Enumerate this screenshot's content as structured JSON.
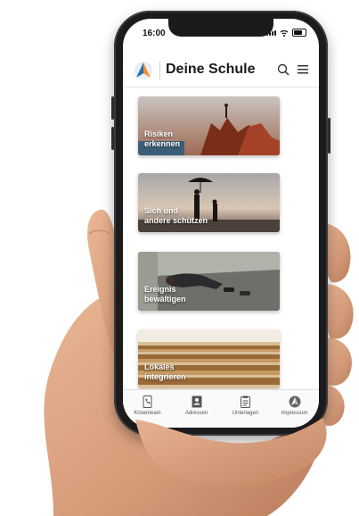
{
  "status": {
    "time": "16:00"
  },
  "app": {
    "title": "Deine Schule"
  },
  "cards": [
    {
      "label": "Risiken\nerkennen"
    },
    {
      "label": "Sich und\nandere schützen"
    },
    {
      "label": "Ereignis\nbewältigen"
    },
    {
      "label": "Lokales\nintegrieren"
    }
  ],
  "tabs": [
    {
      "label": "Krisenteam",
      "icon": "phone-icon"
    },
    {
      "label": "Adressen",
      "icon": "contact-card-icon"
    },
    {
      "label": "Unterlagen",
      "icon": "clipboard-icon"
    },
    {
      "label": "Impressum",
      "icon": "logo-icon"
    }
  ],
  "colors": {
    "brand_blue": "#1f6fb5",
    "brand_orange": "#f0922b",
    "accent_teal": "#2a8fa6"
  }
}
